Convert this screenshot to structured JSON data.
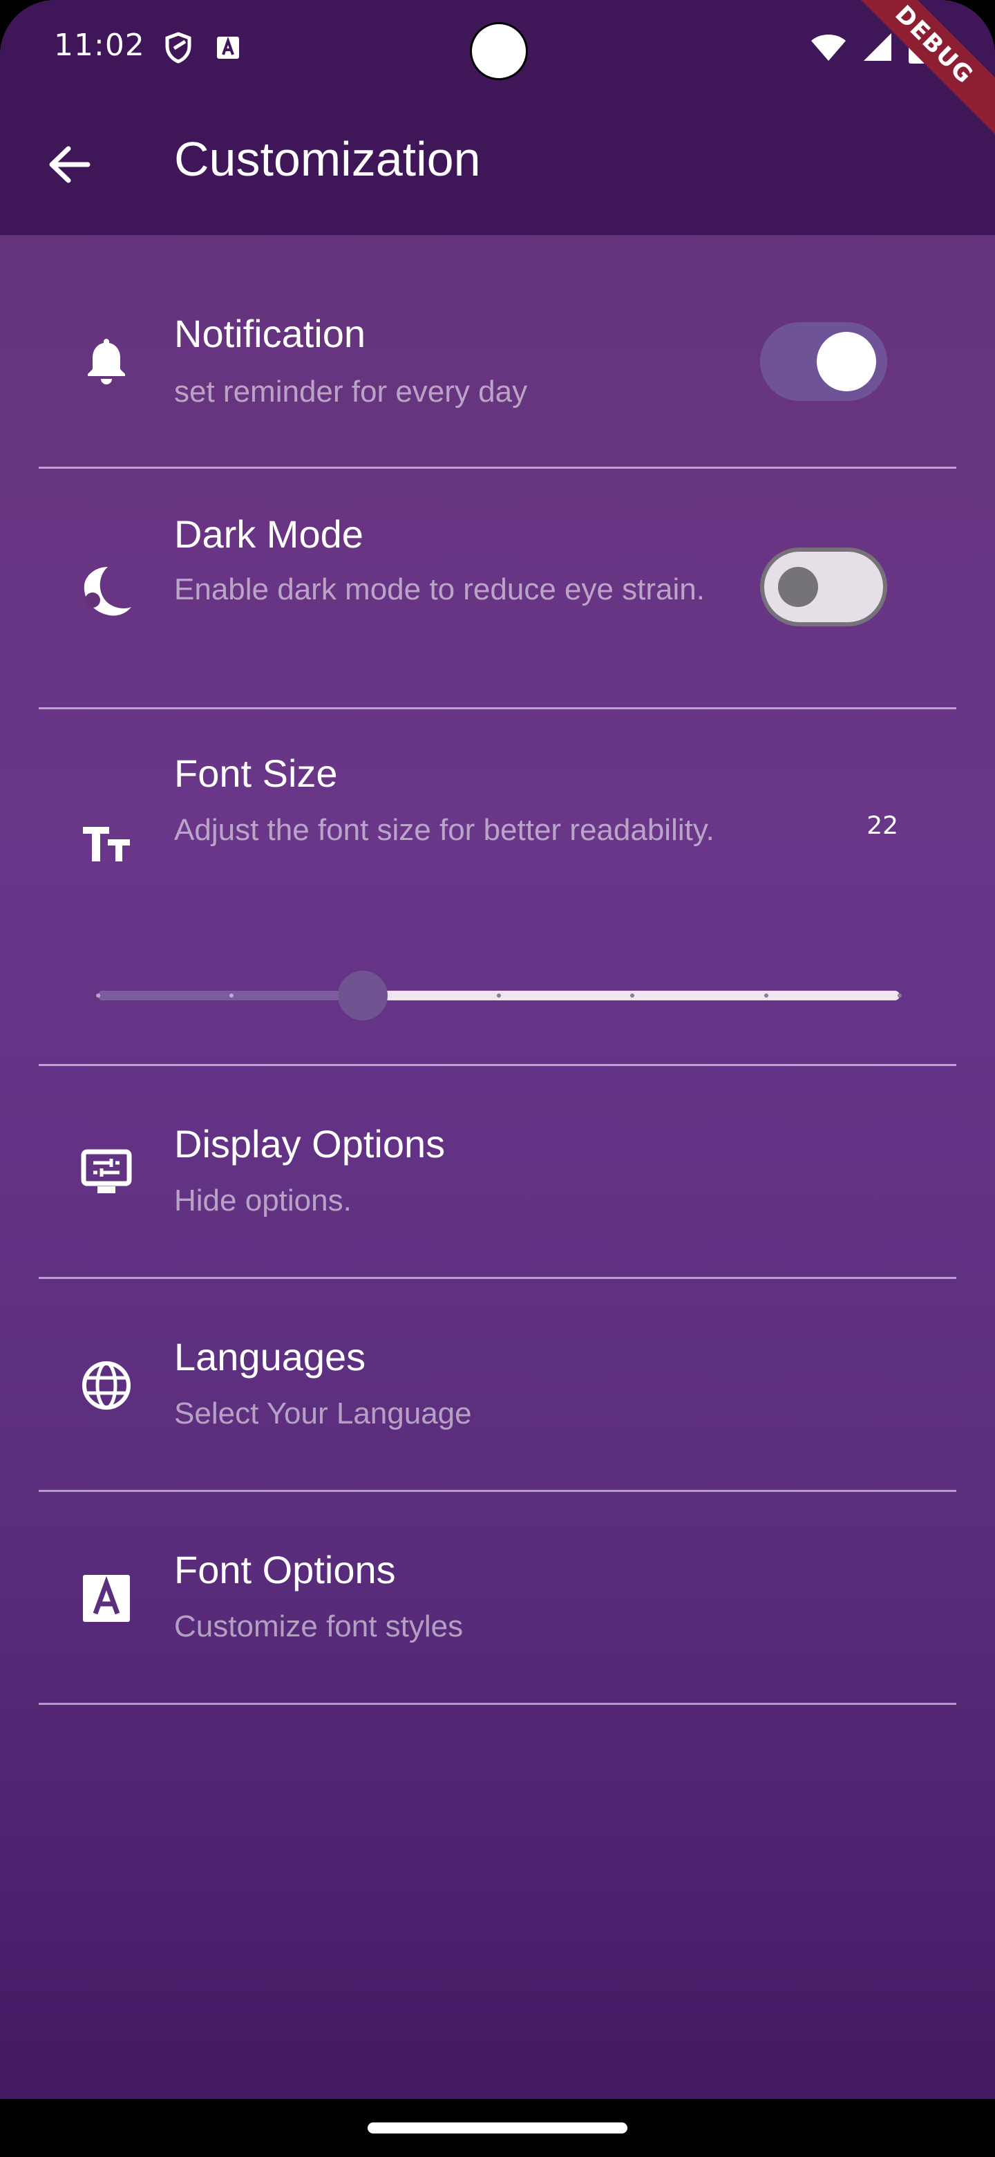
{
  "status_bar": {
    "time": "11:02",
    "icons": [
      "shield-icon",
      "keyboard-a-icon",
      "wifi-icon",
      "cell-signal-icon",
      "battery-icon"
    ]
  },
  "debug_banner": "DEBUG",
  "app_bar": {
    "back_icon": "arrow-back-icon",
    "title": "Customization"
  },
  "settings": {
    "notification": {
      "icon": "bell-icon",
      "title": "Notification",
      "subtitle": "set reminder for every day",
      "enabled": true
    },
    "dark_mode": {
      "icon": "moon-icon",
      "title": "Dark Mode",
      "subtitle": "Enable dark mode to reduce eye strain.",
      "enabled": false
    },
    "font_size": {
      "icon": "text-size-icon",
      "title": "Font Size",
      "subtitle": "Adjust the font size for better readability.",
      "value": "22",
      "slider_fraction": 0.33
    },
    "display_options": {
      "icon": "display-settings-icon",
      "title": "Display Options",
      "subtitle": "Hide options."
    },
    "languages": {
      "icon": "globe-icon",
      "title": "Languages",
      "subtitle": "Select Your Language"
    },
    "font_options": {
      "icon": "font-a-icon",
      "title": "Font Options",
      "subtitle": "Customize font styles"
    }
  },
  "colors": {
    "header": "#3f1658",
    "switch_on_track": "#6e5398",
    "switch_off_track": "#e6dfe8",
    "slider_active": "#7b5c9c",
    "debug_banner": "#8e1f32"
  }
}
